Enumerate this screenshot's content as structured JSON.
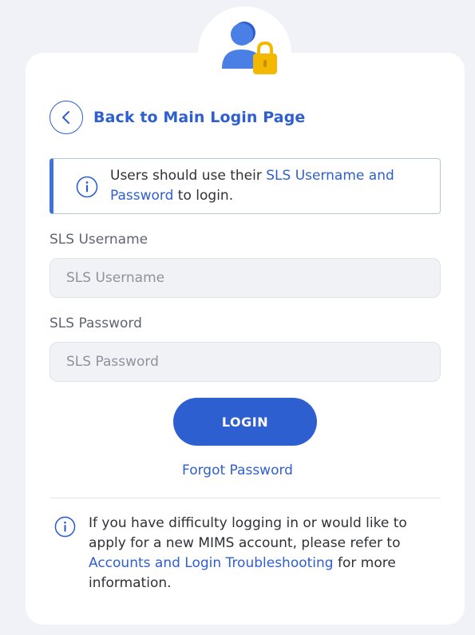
{
  "colors": {
    "accent": "#2e5fd0",
    "lock": "#f5b800",
    "background": "#f1f2f8",
    "card": "#ffffff"
  },
  "header": {
    "icon": "user-lock-icon"
  },
  "back": {
    "icon": "chevron-left-icon",
    "label": "Back to Main Login Page"
  },
  "notice": {
    "icon": "info-icon",
    "text_before": "Users should use their ",
    "link": "SLS Username and Password",
    "text_after": " to login."
  },
  "form": {
    "username_label": "SLS Username",
    "username_placeholder": "SLS Username",
    "password_label": "SLS Password",
    "password_placeholder": "SLS Password",
    "login_label": "LOGIN",
    "forgot_label": "Forgot Password"
  },
  "help": {
    "icon": "info-icon",
    "text_before": "If you have difficulty logging in or would like to apply for a new MIMS account, please refer to ",
    "link": "Accounts and Login Troubleshooting",
    "text_after": " for more information."
  }
}
